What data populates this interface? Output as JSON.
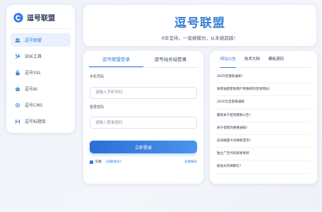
{
  "brand": {
    "name": "逗号联盟"
  },
  "sidebar": {
    "items": [
      {
        "label": "逗号联盟",
        "icon": "users-icon",
        "active": true
      },
      {
        "label": "站长工具",
        "icon": "tools-icon",
        "active": false
      },
      {
        "label": "逗号SSL",
        "icon": "lock-icon",
        "active": false
      },
      {
        "label": "逗号AI",
        "icon": "robot-icon",
        "active": false
      },
      {
        "label": "逗号CMS",
        "icon": "gear-icon",
        "active": false
      },
      {
        "label": "逗号标题库",
        "icon": "heading-icon",
        "active": false
      }
    ]
  },
  "header": {
    "title": "逗号联盟",
    "subtitle": "6年坚持，一直被模仿，从未被超越！"
  },
  "login": {
    "tabs": [
      "逗号联盟登录",
      "逗号站长站登录"
    ],
    "phone_label": "手机号码",
    "phone_placeholder": "请输入手机号码",
    "password_label": "登录密码",
    "password_placeholder": "请输入登录密码",
    "submit_label": "立即登录",
    "agree_text": "同意",
    "agreement_link": "《注册协议》",
    "register_link": "注册账号"
  },
  "notices": {
    "tabs": [
      "网站公告",
      "技术文档",
      "模板源码"
    ],
    "items": [
      "2025年放假通知！",
      "请率独游客链用户更换新的签到网址！",
      "2020元旦放假通知",
      "最新关于提现需要公告！",
      "关于提现的重要通知！",
      "逗号联盟今日换新首页！",
      "独立广告代码即将更新",
      "给站长的致歉信！"
    ]
  },
  "colors": {
    "accent": "#2f7de1",
    "title": "#3a7fd5"
  }
}
